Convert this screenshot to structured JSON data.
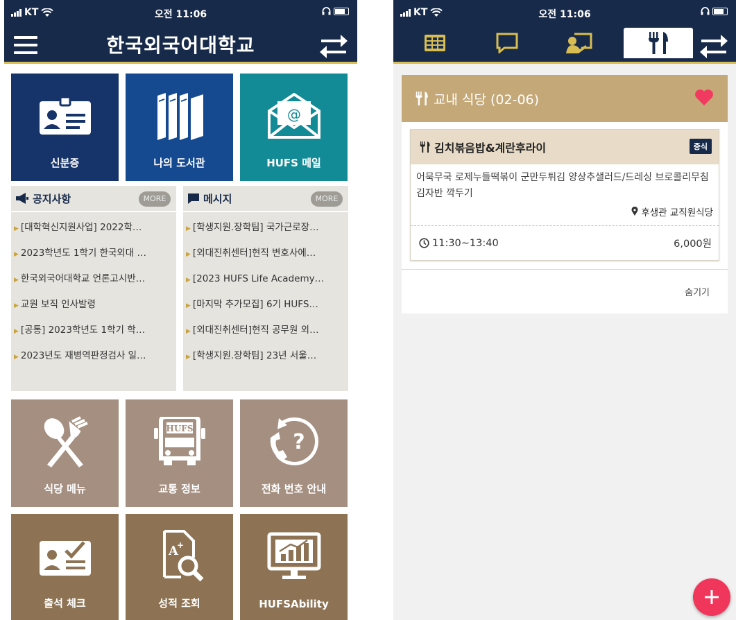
{
  "status": {
    "carrier": "KT",
    "time": "오전 11:06"
  },
  "left": {
    "app_title": "한국외국어대학교",
    "colors": {
      "header": "#172a4a",
      "accent_gold": "#d8bd52",
      "tile_navy": "#163469",
      "tile_blue": "#154a90",
      "tile_teal": "#138b96",
      "tile_taupe": "#a48f80",
      "tile_brown": "#8d7353"
    },
    "top_tiles": [
      {
        "label": "신분증",
        "icon": "id-card-icon"
      },
      {
        "label": "나의 도서관",
        "icon": "books-icon"
      },
      {
        "label": "HUFS 메일",
        "icon": "email-icon"
      }
    ],
    "notices": {
      "title": "공지사항",
      "more": "MORE",
      "items": [
        "[대학혁신지원사업] 2022학…",
        "2023학년도 1학기 한국외대 …",
        "한국외국어대학교 언론고시반…",
        "교원 보직 인사발령",
        "[공통] 2023학년도 1학기 학…",
        "2023년도 재병역판정검사 일…"
      ]
    },
    "messages": {
      "title": "메시지",
      "more": "MORE",
      "items": [
        "[학생지원.장학팀] 국가근로장…",
        "[외대진취센터]현직 변호사에…",
        "[2023 HUFS Life Academy…",
        "[마지막 추가모집] 6기 HUFS…",
        "[외대진취센터]현직 공무원 외…",
        "[학생지원.장학팀] 23년 서울…"
      ]
    },
    "bottom_tiles": [
      {
        "label": "식당 메뉴",
        "icon": "fork-spoon-icon"
      },
      {
        "label": "교통 정보",
        "icon": "bus-icon",
        "icon_text": "HUFS"
      },
      {
        "label": "전화 번호 안내",
        "icon": "phone-help-icon"
      },
      {
        "label": "출석 체크",
        "icon": "attendance-icon"
      },
      {
        "label": "성적 조회",
        "icon": "grade-search-icon"
      },
      {
        "label": "HUFSAbility",
        "icon": "monitor-chart-icon"
      }
    ]
  },
  "right": {
    "tabs": [
      {
        "icon": "grid-icon"
      },
      {
        "icon": "chat-icon"
      },
      {
        "icon": "lecture-icon"
      },
      {
        "icon": "fork-knife-icon",
        "active": true
      }
    ],
    "cafeteria": {
      "title": "교내 식당 (02-06)",
      "menu": {
        "name": "김치볶음밥&계란후라이",
        "badge": "중식",
        "description": "어묵무국 로제누들떡볶이 군만두튀김 양상추샐러드/드레싱 브로콜리무침 김자반 깍두기",
        "location": "후생관 교직원식당",
        "hours": "11:30~13:40",
        "price": "6,000원"
      },
      "hide_label": "숨기기"
    }
  }
}
